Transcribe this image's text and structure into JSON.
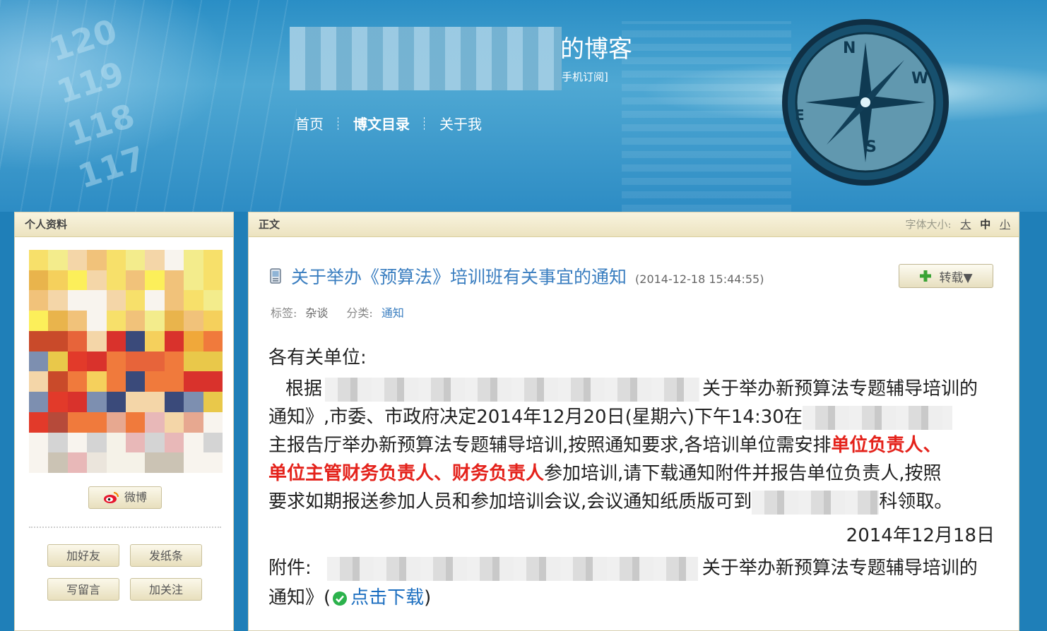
{
  "header": {
    "title_suffix": "的博客",
    "subscribe": "手机订阅]",
    "nav": [
      "首页",
      "博文目录",
      "关于我"
    ],
    "axis_ticks": [
      "120",
      "119",
      "118",
      "117"
    ]
  },
  "sidebar": {
    "title": "个人资料",
    "weibo_label": "微博",
    "buttons": {
      "add_friend": "加好友",
      "send_note": "发纸条",
      "leave_msg": "写留言",
      "follow": "加关注"
    }
  },
  "article": {
    "section_title": "正文",
    "font_size_label": "字体大小:",
    "font_sizes": [
      "大",
      "中",
      "小"
    ],
    "title": "关于举办《预算法》培训班有关事宜的通知",
    "time": "(2014-12-18 15:44:55)",
    "repost": "转载▼",
    "tag_label": "标签:",
    "tag": "杂谈",
    "category_label": "分类:",
    "category": "通知",
    "body": {
      "greeting": "各有关单位:",
      "p1_start": "根据",
      "p1_a": "关于举办新预算法专题辅导培训的",
      "p2": "通知》,市委、市政府决定2014年12月20日(星期六)下午14:30在",
      "p3_a": "主报告厅举办新预算法专题辅导培训,按照通知要求,各培训单位需安排",
      "p3_red": "单位负责人、",
      "p4_red": "单位主管财务负责人、财务负责人",
      "p4_b": "参加培训,请下载通知附件并报告单位负责人,按照",
      "p5_a": "要求如期报送参加人员和参加培训会议,会议通知纸质版可到",
      "p5_b": "科领取。",
      "date": "2014年12月18日",
      "attach_label": "附件:",
      "attach_a": "关于举办新预算法专题辅导培训的",
      "attach_b": "通知》(",
      "download": "点击下载",
      "attach_end": ")"
    }
  },
  "colors": {
    "banner": "#2a8ec5",
    "title_link": "#3a7ec0",
    "emphasis_red": "#e4221b",
    "panel_header": "#ece3c0"
  }
}
